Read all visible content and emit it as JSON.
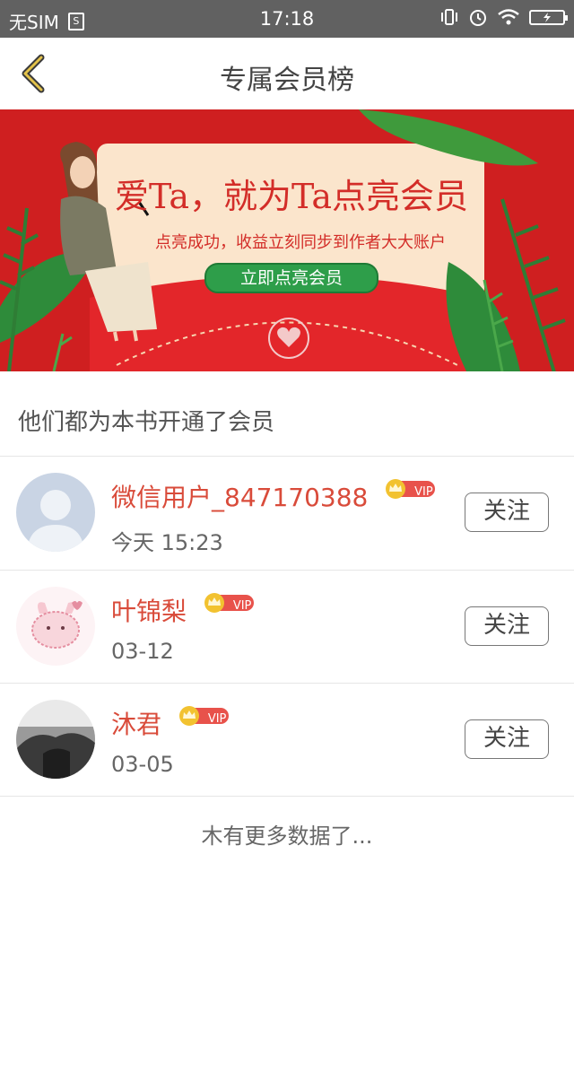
{
  "status_bar": {
    "carrier": "无SIM",
    "sim_icon_glyph": "S",
    "time": "17:18"
  },
  "header": {
    "title": "专属会员榜"
  },
  "banner": {
    "headline": "爱Ta，就为Ta点亮会员",
    "subtitle": "点亮成功，收益立刻同步到作者大大账户",
    "cta_label": "立即点亮会员"
  },
  "section_title": "他们都为本书开通了会员",
  "members": [
    {
      "name": "微信用户_847170388",
      "date": "今天 15:23",
      "follow_label": "关注",
      "vip_label": "VIP"
    },
    {
      "name": "叶锦梨",
      "date": "03-12",
      "follow_label": "关注",
      "vip_label": "VIP"
    },
    {
      "name": "沐君",
      "date": "03-05",
      "follow_label": "关注",
      "vip_label": "VIP"
    }
  ],
  "footer_text": "木有更多数据了...",
  "colors": {
    "banner_red": "#cf1f20",
    "name_red": "#d94b3a",
    "cta_green": "#2e9e4a",
    "back_gold": "#b98f2a"
  }
}
